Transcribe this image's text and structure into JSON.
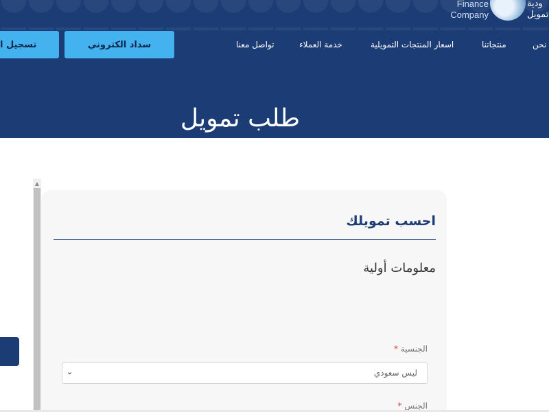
{
  "brand": {
    "name_en": "Finance\nCompany",
    "name_en_line1": "Finance",
    "name_en_line2": "Company",
    "name_ar_line1": "ودية",
    "name_ar_line2": "تمويل"
  },
  "nav": {
    "items": [
      {
        "label": "نحن"
      },
      {
        "label": "منتجاتنا"
      },
      {
        "label": "اسعار المنتجات التمويلية"
      },
      {
        "label": "خدمة العملاء"
      },
      {
        "label": "تواصل معنا"
      }
    ],
    "epay_label": "سداد الكتروني",
    "register_label": "تسجيل ا"
  },
  "hero": {
    "title": "طلب تمويل"
  },
  "form": {
    "card_title": "احسب تمويلك",
    "section_title": "معلومات أولية",
    "nationality": {
      "label": "الجنسية",
      "required_mark": "*",
      "selected": "ليس سعودي"
    },
    "gender": {
      "label": "الجنس",
      "required_mark": "*"
    }
  },
  "colors": {
    "primary": "#1b3c74",
    "accent": "#44b2ee",
    "required": "#e53935"
  }
}
